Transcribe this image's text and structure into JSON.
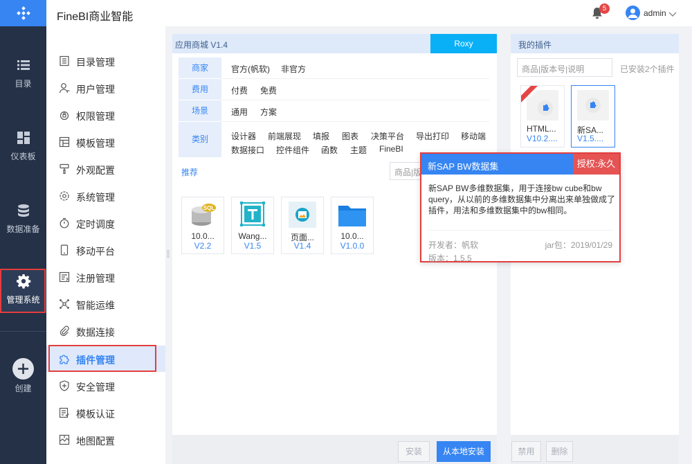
{
  "header": {
    "app_title": "FineBI商业智能",
    "notification_count": "5",
    "user_name": "admin"
  },
  "left_nav": {
    "catalog": "目录",
    "dashboard": "仪表板",
    "data_prep": "数据准备",
    "system_mgmt": "管理系统",
    "create": "创建"
  },
  "sidebar": {
    "items": [
      {
        "label": "目录管理",
        "icon": "list-icon"
      },
      {
        "label": "用户管理",
        "icon": "user-icon"
      },
      {
        "label": "权限管理",
        "icon": "lock-icon"
      },
      {
        "label": "模板管理",
        "icon": "template-icon"
      },
      {
        "label": "外观配置",
        "icon": "brush-icon"
      },
      {
        "label": "系统管理",
        "icon": "gear-icon"
      },
      {
        "label": "定时调度",
        "icon": "timer-icon"
      },
      {
        "label": "移动平台",
        "icon": "mobile-icon"
      },
      {
        "label": "注册管理",
        "icon": "register-icon"
      },
      {
        "label": "智能运维",
        "icon": "network-icon"
      },
      {
        "label": "数据连接",
        "icon": "clip-icon"
      },
      {
        "label": "插件管理",
        "icon": "puzzle-icon"
      },
      {
        "label": "安全管理",
        "icon": "shield-icon"
      },
      {
        "label": "模板认证",
        "icon": "certify-icon"
      },
      {
        "label": "地图配置",
        "icon": "map-icon"
      }
    ]
  },
  "store": {
    "title": "应用商城  V1.4",
    "user_button": "Roxy",
    "filters": {
      "vendor_label": "商家",
      "vendor_opts": [
        "官方(帆软)",
        "非官方"
      ],
      "fee_label": "费用",
      "fee_opts": [
        "付费",
        "免费"
      ],
      "scene_label": "场景",
      "scene_opts": [
        "通用",
        "方案"
      ],
      "category_label": "类别",
      "category_row1": [
        "设计器",
        "前端展现",
        "填报",
        "图表",
        "决策平台",
        "导出打印",
        "移动端"
      ],
      "category_row2": [
        "数据接口",
        "控件组件",
        "函数",
        "主题",
        "FineBI"
      ]
    },
    "recommend_label": "推荐",
    "search_placeholder": "商品|版本号|说明",
    "plugins": [
      {
        "name": "10.0...",
        "version": "V2.2",
        "icon": "sql-database-icon"
      },
      {
        "name": "Wang...",
        "version": "V1.5",
        "icon": "text-t-icon"
      },
      {
        "name": "页面...",
        "version": "V1.4",
        "icon": "image-icon"
      },
      {
        "name": "10.0...",
        "version": "V1.0.0",
        "icon": "folder-icon"
      }
    ],
    "install_button": "安装",
    "install_local_button": "从本地安装"
  },
  "mine": {
    "title": "我的插件",
    "search_placeholder": "商品|版本号|说明",
    "installed_count": "已安装2个插件",
    "plugins": [
      {
        "name": "HTML...",
        "version": "V10.2....",
        "badge": "NEW"
      },
      {
        "name": "新SA...",
        "version": "V1.5...."
      }
    ],
    "disable_button": "禁用",
    "delete_button": "删除"
  },
  "popup": {
    "title": "新SAP BW数据集",
    "license": "授权:永久",
    "description": "新SAP BW多维数据集，用于连接bw cube和bw query，从以前的多维数据集中分离出来单独做成了插件，用法和多维数据集中的bw相同。",
    "developer": "开发者：帆软",
    "jar": "jar包：2019/01/29",
    "version": "版本：1.5.5"
  },
  "colors": {
    "primary": "#3685f2",
    "nav_dark": "#243147",
    "roxy": "#0ab0f6",
    "alert_red": "#e43d3d"
  }
}
